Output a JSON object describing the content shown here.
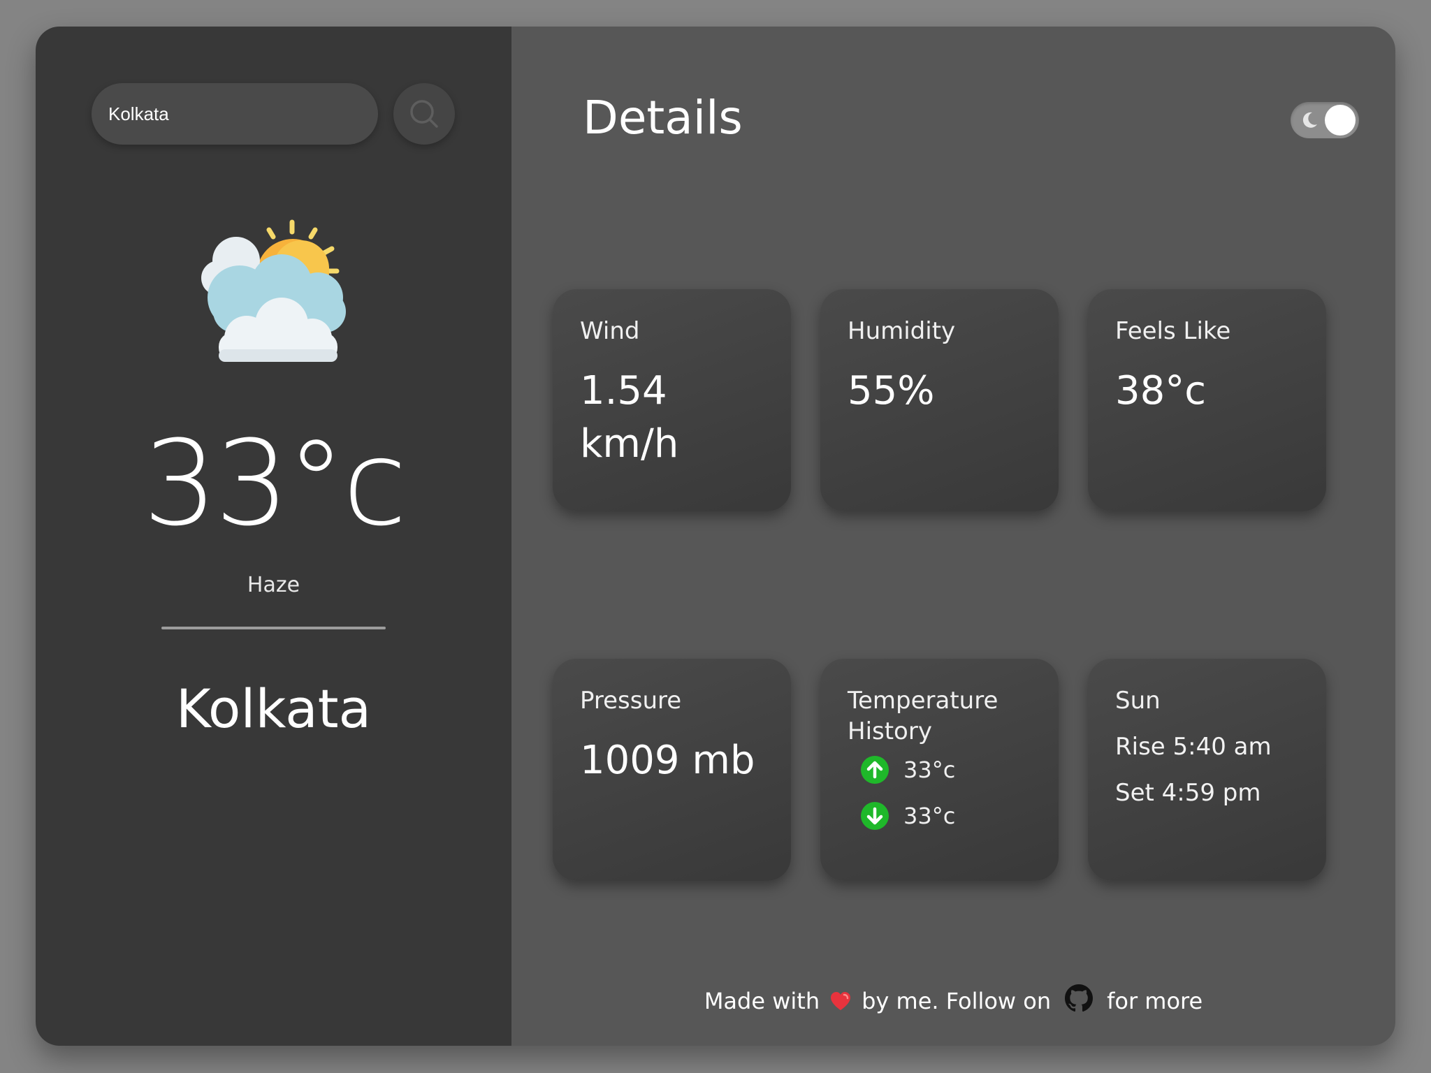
{
  "search": {
    "value": "Kolkata",
    "button_icon": "search-icon"
  },
  "current": {
    "icon": "partly-cloudy-sun-icon",
    "temperature": "33°c",
    "condition": "Haze",
    "city": "Kolkata"
  },
  "details": {
    "title": "Details",
    "theme_toggle_icon": "moon-icon"
  },
  "cards": {
    "wind": {
      "label": "Wind",
      "value": "1.54 km/h"
    },
    "humidity": {
      "label": "Humidity",
      "value": "55%"
    },
    "feels_like": {
      "label": "Feels Like",
      "value": "38°c"
    },
    "pressure": {
      "label": "Pressure",
      "value": "1009 mb"
    },
    "temperature_history": {
      "label": "Temperature History",
      "high": "33°c",
      "low": "33°c"
    },
    "sun": {
      "label": "Sun",
      "rise": "Rise 5:40 am",
      "set": "Set 4:59 pm"
    }
  },
  "footer": {
    "text_before": "Made with",
    "text_middle": "by me. Follow on",
    "text_after": "for more",
    "heart_icon": "heart-icon",
    "github_icon": "github-icon"
  },
  "colors": {
    "page_background": "#848484",
    "left_panel": "#383838",
    "right_panel": "#575757",
    "accent_green": "#1fb82a",
    "heart_red": "#e8333d"
  }
}
